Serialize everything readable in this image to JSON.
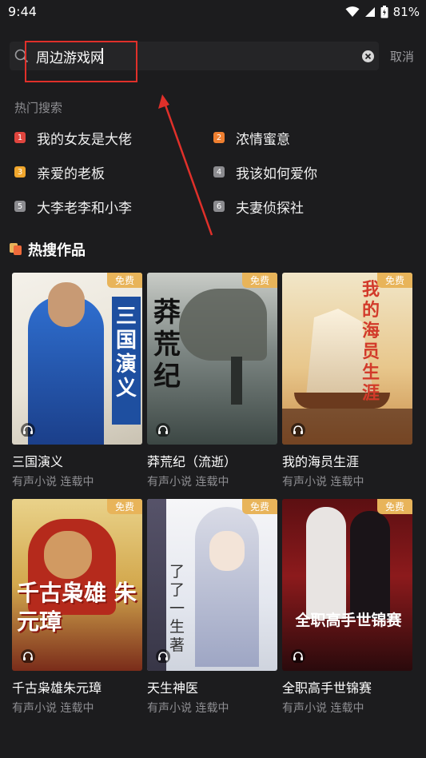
{
  "status": {
    "time": "9:44",
    "battery": "81%"
  },
  "search": {
    "value": "周边游戏网",
    "cancel_label": "取消"
  },
  "hot_search": {
    "title": "热门搜索",
    "items": [
      {
        "rank": "1",
        "label": "我的女友是大佬",
        "color": "#e0453e"
      },
      {
        "rank": "2",
        "label": "浓情蜜意",
        "color": "#ef7f30"
      },
      {
        "rank": "3",
        "label": "亲爱的老板",
        "color": "#f0a62c"
      },
      {
        "rank": "4",
        "label": "我该如何爱你",
        "color": "#8c8c90"
      },
      {
        "rank": "5",
        "label": "大李老李和小李",
        "color": "#8c8c90"
      },
      {
        "rank": "6",
        "label": "夫妻侦探社",
        "color": "#8c8c90"
      }
    ]
  },
  "hot_works": {
    "title": "热搜作品",
    "badge": "免费",
    "books": [
      {
        "title": "三国演义",
        "subtitle": "有声小说 连载中",
        "cover_text": "三国演义"
      },
      {
        "title": "莽荒纪（流逝）",
        "subtitle": "有声小说 连载中",
        "cover_text": "莽荒纪"
      },
      {
        "title": "我的海员生涯",
        "subtitle": "有声小说 连载中",
        "cover_text": "我的海员生涯"
      },
      {
        "title": "千古枭雄朱元璋",
        "subtitle": "有声小说 连载中",
        "cover_text": "千古枭雄 朱元璋"
      },
      {
        "title": "天生神医",
        "subtitle": "有声小说 连载中",
        "cover_text": "了了一生 著"
      },
      {
        "title": "全职高手世锦赛",
        "subtitle": "有声小说 连载中",
        "cover_text": "全职高手世锦赛"
      }
    ]
  },
  "colors": {
    "background": "#1c1c1e",
    "free_badge": "#e8b45a",
    "annotation": "#e0302a"
  }
}
